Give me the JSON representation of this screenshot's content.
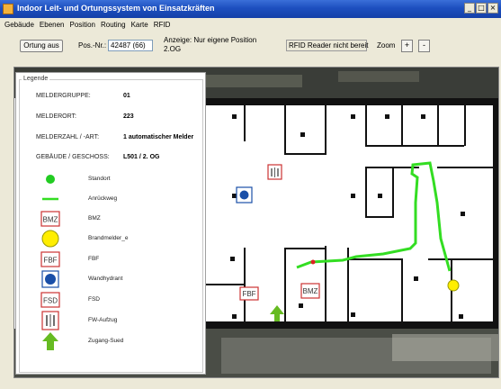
{
  "window": {
    "title": "Indoor Leit- und Ortungssystem von Einsatzkräften",
    "minimize_icon": "minimize-icon",
    "maximize_icon": "maximize-icon",
    "close_icon": "close-icon"
  },
  "menu": [
    "Gebäude",
    "Ebenen",
    "Position",
    "Routing",
    "Karte",
    "RFID"
  ],
  "toolbar": {
    "ortung_button": "Ortung aus",
    "pos_label": "Pos.-Nr.:",
    "pos_value": "42487 (66)",
    "anzeige_label": "Anzeige: Nur eigene Position",
    "anzeige_value": "2.OG",
    "rfid_status": "RFID Reader nicht bereit",
    "zoom_label": "Zoom",
    "zoom_in": "+",
    "zoom_out": "-"
  },
  "legend": {
    "title": "Legende",
    "info": [
      {
        "label": "MELDERGRUPPE:",
        "value": "01"
      },
      {
        "label": "MELDERORT:",
        "value": "223"
      },
      {
        "label": "MELDERZAHL / -ART:",
        "value": "1 automatischer Melder"
      },
      {
        "label": "GEBÄUDE / GESCHOSS:",
        "value": "L501 / 2. OG"
      }
    ],
    "items": [
      {
        "icon": "standort-icon",
        "label": "Standort"
      },
      {
        "icon": "anrueckweg-icon",
        "label": "Anrückweg"
      },
      {
        "icon": "bmz-icon",
        "icon_text": "BMZ",
        "label": "BMZ"
      },
      {
        "icon": "brandmelder-icon",
        "label": "Brandmelder_e"
      },
      {
        "icon": "fbf-icon",
        "icon_text": "FBF",
        "label": "FBF"
      },
      {
        "icon": "wandhydrant-icon",
        "label": "Wandhydrant"
      },
      {
        "icon": "fsd-icon",
        "icon_text": "FSD",
        "label": "FSD"
      },
      {
        "icon": "fw-aufzug-icon",
        "label": "FW-Aufzug"
      },
      {
        "icon": "zugang-icon",
        "label": "Zugang-Sued"
      }
    ]
  },
  "map": {
    "markers": {
      "fbf": "FBF",
      "bmz": "BMZ"
    }
  },
  "colors": {
    "route": "#33dd22",
    "standort": "#22cc22",
    "brandmelder": "#ffee00",
    "symbol_border": "#cc3333",
    "hydrant": "#1a4fa8",
    "zugang": "#66bb22",
    "title_bar": "#1d4fbf"
  }
}
